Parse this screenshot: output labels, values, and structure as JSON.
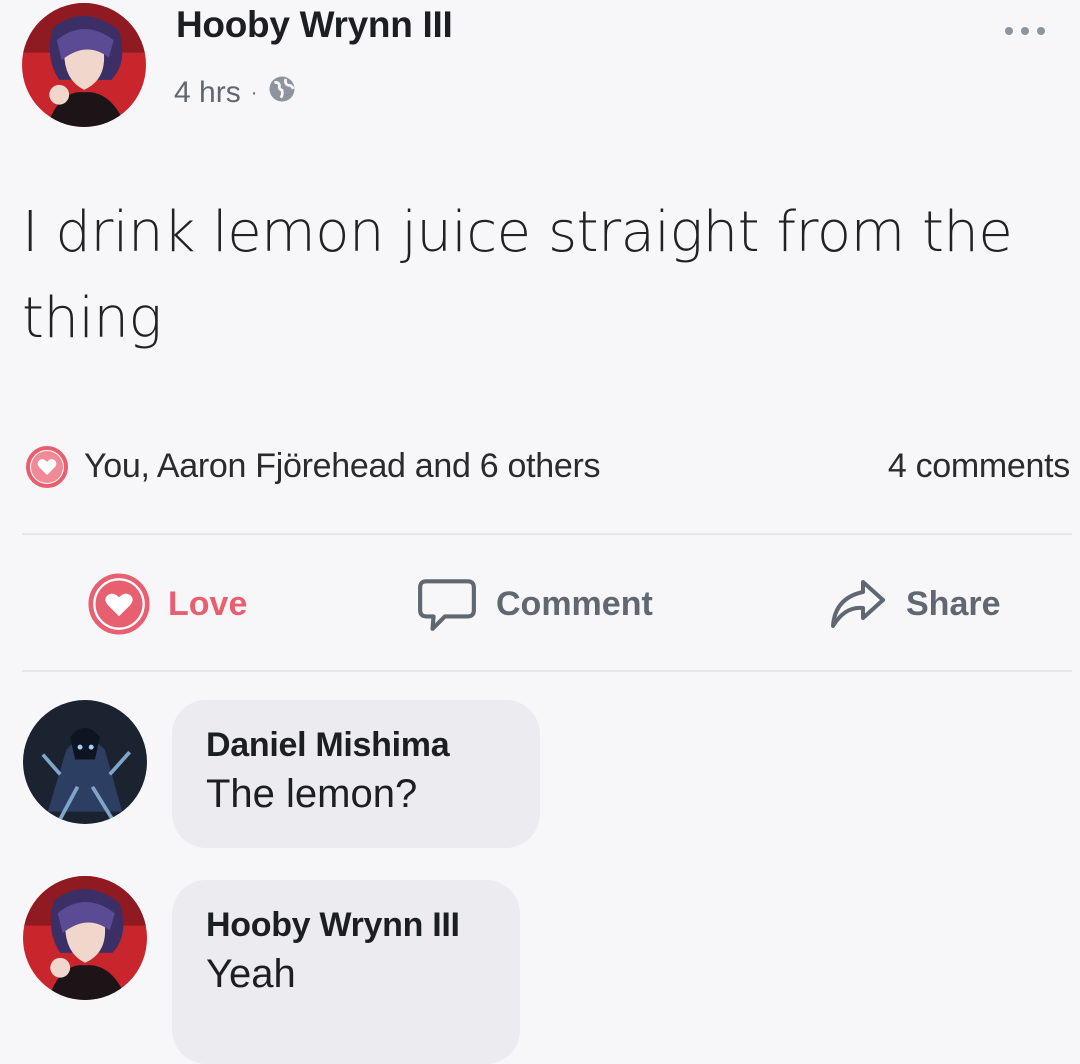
{
  "post": {
    "author": "Hooby Wrynn III",
    "time": "4 hrs",
    "separator": "·",
    "privacy_icon": "globe-icon",
    "text": "I drink lemon juice straight from the thing",
    "more_icon": "more-options-icon"
  },
  "reactions": {
    "icon": "heart-icon",
    "summary": "You, Aaron Fjörehead and 6 others",
    "comments_count": "4 comments"
  },
  "actions": {
    "love": "Love",
    "comment": "Comment",
    "share": "Share"
  },
  "comments": [
    {
      "name": "Daniel Mishima",
      "text": "The lemon?"
    },
    {
      "name": "Hooby Wrynn III",
      "text": "Yeah"
    }
  ],
  "colors": {
    "love_accent": "#e85f70",
    "muted_text": "#606770",
    "bubble_bg": "#ececf0"
  }
}
